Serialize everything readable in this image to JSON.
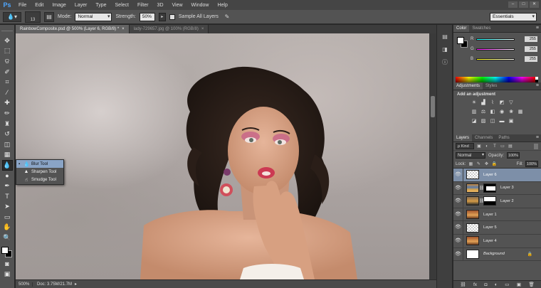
{
  "app": {
    "logo": "Ps",
    "menu": [
      "File",
      "Edit",
      "Image",
      "Layer",
      "Type",
      "Select",
      "Filter",
      "3D",
      "View",
      "Window",
      "Help"
    ]
  },
  "options": {
    "brush_size": "13",
    "mode_label": "Mode:",
    "mode_value": "Normal",
    "strength_label": "Strength:",
    "strength_value": "50%",
    "sample_all_label": "Sample All Layers",
    "workspace": "Essentials"
  },
  "document_tabs": [
    {
      "label": "RainbowComposite.psd @ 500% (Layer 6, RGB/8) *",
      "active": true
    },
    {
      "label": "lady-729657.jpg @ 100% (RGB/8)",
      "active": false
    }
  ],
  "flyout": {
    "items": [
      "Blur Tool",
      "Sharpen Tool",
      "Smudge Tool"
    ]
  },
  "status": {
    "zoom": "500%",
    "doc": "Doc: 3.75M/21.7M"
  },
  "panels": {
    "color_tabs": [
      "Color",
      "Swatches"
    ],
    "channels": [
      {
        "label": "R",
        "value": "255",
        "color": "#ff3b3b"
      },
      {
        "label": "G",
        "value": "255",
        "color": "#e64bd8"
      },
      {
        "label": "B",
        "value": "255",
        "color": "#f3e33a"
      }
    ],
    "adjustment_tabs": [
      "Adjustments",
      "Styles"
    ],
    "adjustment_title": "Add an adjustment",
    "layers_tabs": [
      "Layers",
      "Channels",
      "Paths"
    ],
    "kind_label": "Kind",
    "blend_mode": "Normal",
    "opacity_label": "Opacity:",
    "opacity_value": "100%",
    "lock_label": "Lock:",
    "fill_label": "Fill:",
    "fill_value": "100%",
    "layers": [
      {
        "name": "Layer 6",
        "active": true
      },
      {
        "name": "Layer 3",
        "active": false
      },
      {
        "name": "Layer 2",
        "active": false
      },
      {
        "name": "Layer 1",
        "active": false
      },
      {
        "name": "Layer 5",
        "active": false
      },
      {
        "name": "Layer 4",
        "active": false
      },
      {
        "name": "Background",
        "active": false
      }
    ]
  }
}
